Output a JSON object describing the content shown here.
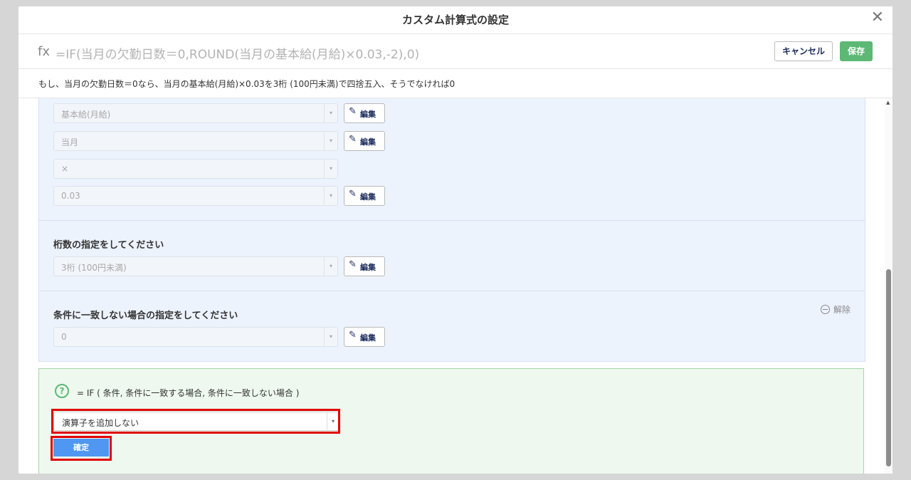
{
  "dialog": {
    "title": "カスタム計算式の設定",
    "close_glyph": "✕"
  },
  "formula": {
    "fx_label": "fx",
    "expression": "=IF(当月の欠勤日数＝0,ROUND(当月の基本給(月給)×0.03,-2),0)"
  },
  "actions": {
    "cancel_label": "キャンセル",
    "save_label": "保存",
    "save_color": "#5cb874"
  },
  "description": "もし、当月の欠勤日数＝0なら、当月の基本給(月給)×0.03を3桁 (100円未満)で四捨五入、そうでなければ0",
  "top_rows": [
    {
      "value": "基本給(月給)",
      "edit": "編集"
    },
    {
      "value": "当月",
      "edit": "編集"
    },
    {
      "value": "×"
    },
    {
      "value": "0.03",
      "edit": "編集"
    }
  ],
  "digits_section": {
    "label": "桁数の指定をしてください",
    "value": "3桁 (100円未満)",
    "edit": "編集"
  },
  "else_section": {
    "label": "条件に一致しない場合の指定をしてください",
    "remove_label": "解除",
    "value": "0",
    "edit": "編集"
  },
  "function_helper": {
    "help_glyph": "?",
    "syntax": "= IF ( 条件, 条件に一致する場合, 条件に一致しない場合 )",
    "operator_select": "演算子を追加しない",
    "confirm_label": "確定",
    "confirm_color": "#4f97f0",
    "highlight_color": "#e00000"
  },
  "icons": {
    "caret": "▾",
    "pencil": "✎",
    "scroll_up": "▲"
  }
}
